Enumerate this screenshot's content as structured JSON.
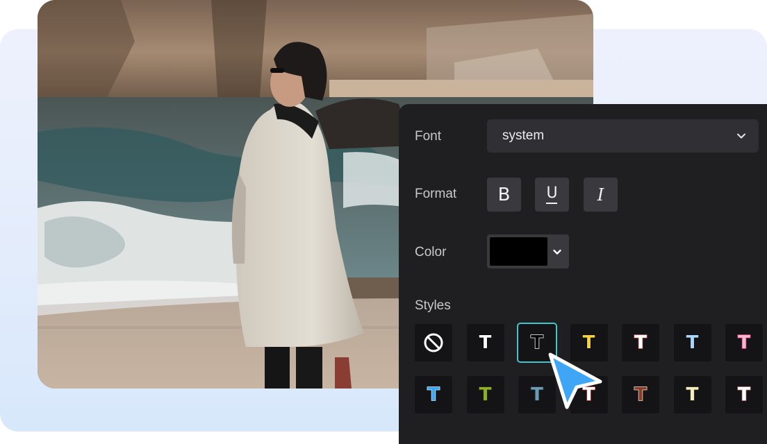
{
  "editor": {
    "font": {
      "label": "Font",
      "value": "system"
    },
    "format": {
      "label": "Format",
      "bold": "B",
      "underline": "U",
      "italic": "I"
    },
    "color": {
      "label": "Color",
      "value": "#000000"
    },
    "styles": {
      "label": "Styles",
      "row1": [
        {
          "kind": "none",
          "icon": "no-style-icon"
        },
        {
          "glyph": "T",
          "fill": "#ffffff",
          "stroke": "#000000"
        },
        {
          "glyph": "T",
          "fill": "#000000",
          "stroke": "#ffffff",
          "selected": true
        },
        {
          "glyph": "T",
          "fill": "#f5d33a",
          "stroke": "#000000"
        },
        {
          "glyph": "T",
          "fill": "#ffffff",
          "stroke": "#e86a6a"
        },
        {
          "glyph": "T",
          "fill": "#a9d6ff",
          "stroke": "#0b0b0b"
        },
        {
          "glyph": "T",
          "fill": "#f7b7cf",
          "stroke": "#e5447e"
        }
      ],
      "row2": [
        {
          "glyph": "T",
          "fill": "#3aa7f0",
          "stroke": "#d9f0ff"
        },
        {
          "glyph": "T",
          "fill": "#8fae2c",
          "stroke": "#1a2a08"
        },
        {
          "glyph": "T",
          "fill": "#6b9cb4",
          "stroke": "#1b2a33"
        },
        {
          "glyph": "T",
          "fill": "#ffffff",
          "stroke": "#e03a3a"
        },
        {
          "glyph": "T",
          "fill": "#8a3b25",
          "stroke": "#f5e7d8"
        },
        {
          "glyph": "T",
          "fill": "#f4efc2",
          "stroke": "#3a3620"
        },
        {
          "glyph": "T",
          "fill": "#ffffff",
          "stroke": "#e08f8f"
        }
      ]
    }
  },
  "colors": {
    "panel": "#1f1f22",
    "accent": "#3fc6cf",
    "cursor": "#3fa6f5"
  }
}
